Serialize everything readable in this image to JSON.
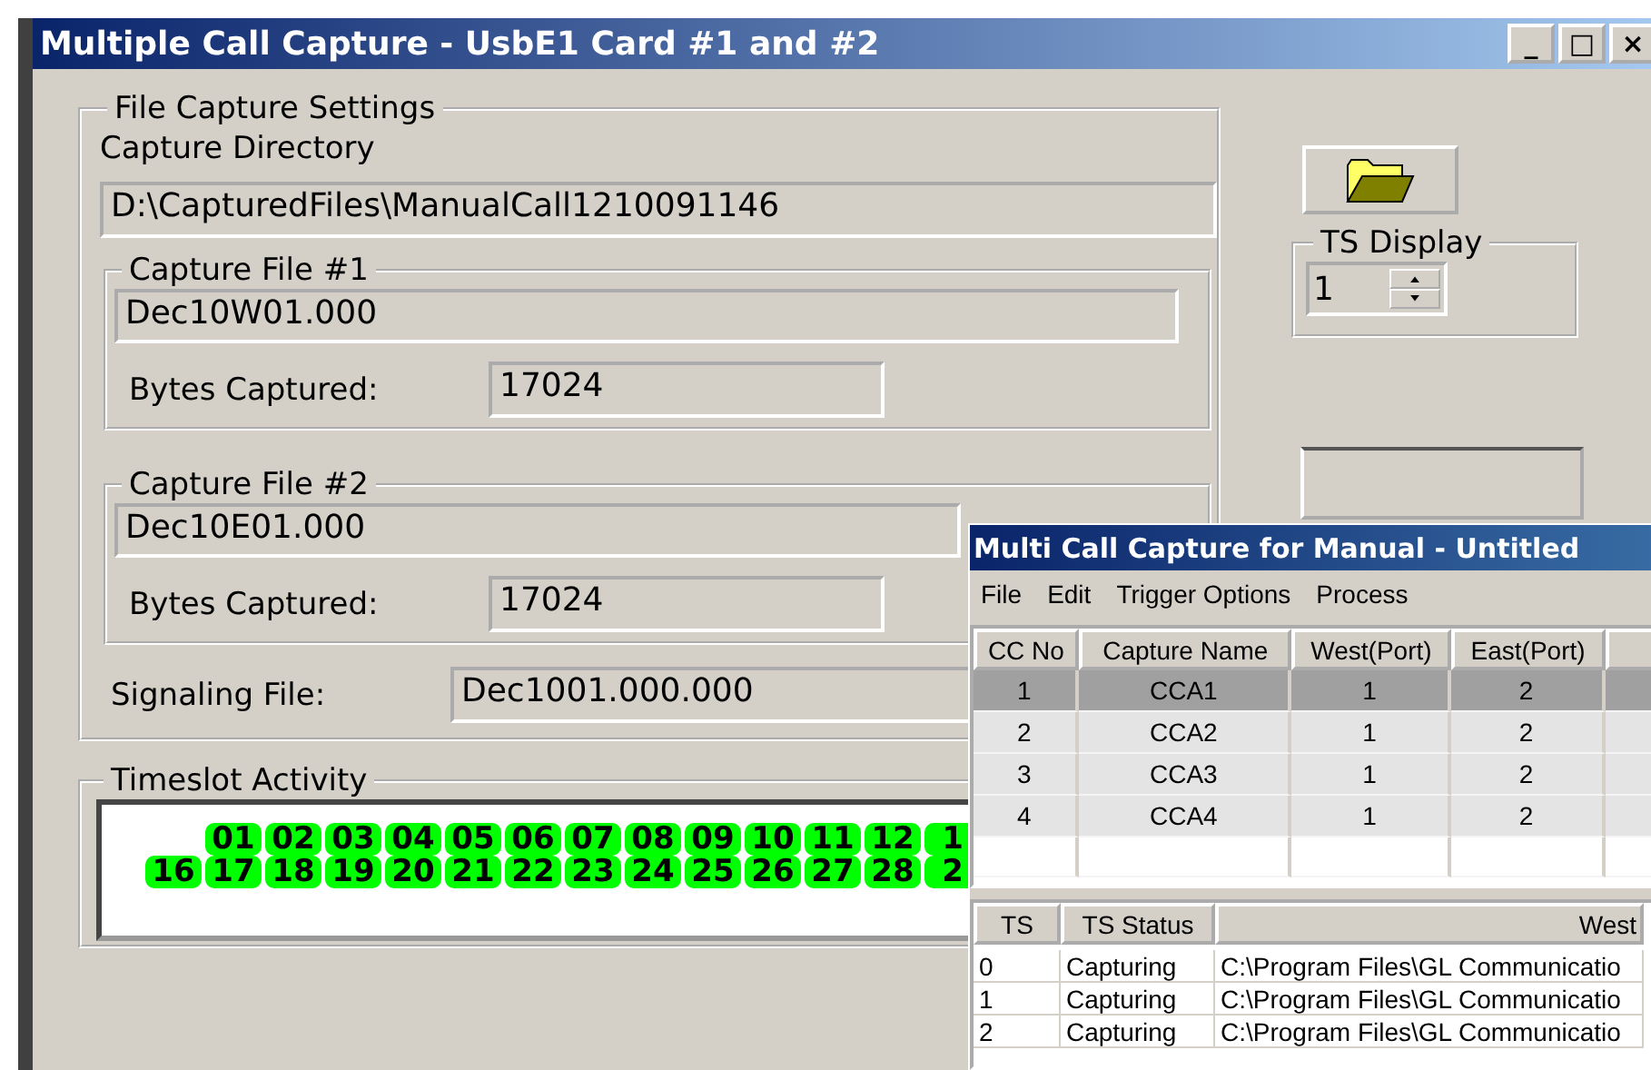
{
  "window": {
    "title": "Multiple Call Capture - UsbE1 Card #1 and #2",
    "controls": [
      "_",
      "□",
      "×"
    ]
  },
  "file_capture_settings": {
    "title": "File Capture Settings",
    "directory_label": "Capture Directory",
    "directory_value": "D:\\CapturedFiles\\ManualCall1210091146",
    "capture_files": [
      {
        "title": "Capture File #1",
        "file_value": "Dec10W01.000",
        "bytes_label": "Bytes Captured:",
        "bytes_value": "17024"
      },
      {
        "title": "Capture File #2",
        "file_value": "Dec10E01.000",
        "bytes_label": "Bytes Captured:",
        "bytes_value": "17024"
      }
    ],
    "signaling_label": "Signaling File:",
    "signaling_value": "Dec1001.000.000"
  },
  "ts_display": {
    "title": "TS Display",
    "value": "1"
  },
  "timeslot_activity": {
    "title": "Timeslot Activity",
    "rows": [
      [
        null,
        {
          "label": "01",
          "active": true
        },
        {
          "label": "02",
          "active": true
        },
        {
          "label": "03",
          "active": true
        },
        {
          "label": "04",
          "active": true
        },
        {
          "label": "05",
          "active": true
        },
        {
          "label": "06",
          "active": true
        },
        {
          "label": "07",
          "active": true
        },
        {
          "label": "08",
          "active": true
        },
        {
          "label": "09",
          "active": true
        },
        {
          "label": "10",
          "active": true
        },
        {
          "label": "11",
          "active": true
        },
        {
          "label": "12",
          "active": true
        },
        {
          "label": "1",
          "active": true
        }
      ],
      [
        {
          "label": "16",
          "active": true
        },
        {
          "label": "17",
          "active": true
        },
        {
          "label": "18",
          "active": true
        },
        {
          "label": "19",
          "active": true
        },
        {
          "label": "20",
          "active": true
        },
        {
          "label": "21",
          "active": true
        },
        {
          "label": "22",
          "active": true
        },
        {
          "label": "23",
          "active": true
        },
        {
          "label": "24",
          "active": true
        },
        {
          "label": "25",
          "active": true
        },
        {
          "label": "26",
          "active": true
        },
        {
          "label": "27",
          "active": true
        },
        {
          "label": "28",
          "active": true
        },
        {
          "label": "2",
          "active": true
        }
      ]
    ]
  },
  "child_window": {
    "title": "Multi Call Capture for Manual - Untitled",
    "menu": [
      "File",
      "Edit",
      "Trigger Options",
      "Process"
    ],
    "capture_table": {
      "columns": [
        "CC No",
        "Capture Name",
        "West(Port)",
        "East(Port)"
      ],
      "rows": [
        {
          "cells": [
            "1",
            "CCA1",
            "1",
            "2"
          ],
          "selected": true
        },
        {
          "cells": [
            "2",
            "CCA2",
            "1",
            "2"
          ],
          "selected": false
        },
        {
          "cells": [
            "3",
            "CCA3",
            "1",
            "2"
          ],
          "selected": false
        },
        {
          "cells": [
            "4",
            "CCA4",
            "1",
            "2"
          ],
          "selected": false
        }
      ]
    },
    "ts_table": {
      "columns": [
        "TS",
        "TS Status",
        "West"
      ],
      "rows": [
        [
          "0",
          "Capturing",
          "C:\\Program Files\\GL Communicatio"
        ],
        [
          "1",
          "Capturing",
          "C:\\Program Files\\GL Communicatio"
        ],
        [
          "2",
          "Capturing",
          "C:\\Program Files\\GL Communicatio"
        ]
      ]
    }
  }
}
